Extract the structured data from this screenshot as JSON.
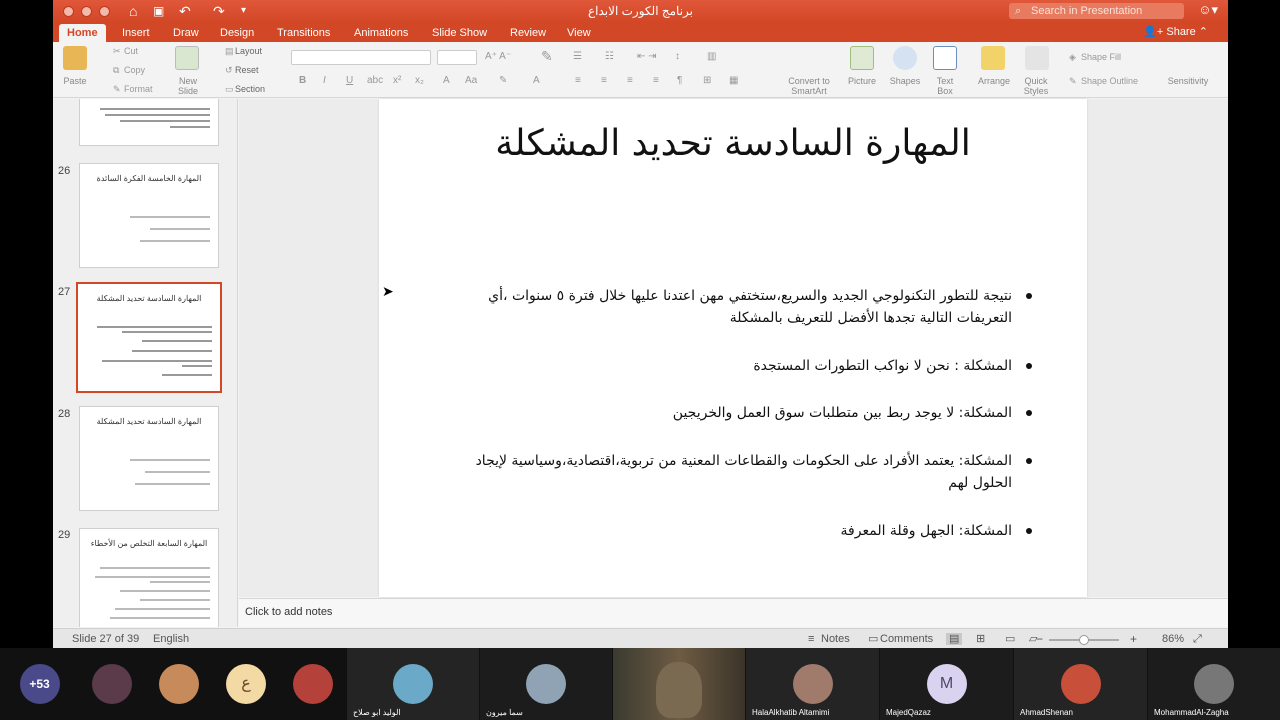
{
  "window": {
    "title": "برنامج الكورت الابداع"
  },
  "search": {
    "placeholder": "Search in Presentation"
  },
  "share_label": "Share",
  "tabs": [
    "Home",
    "Insert",
    "Draw",
    "Design",
    "Transitions",
    "Animations",
    "Slide Show",
    "Review",
    "View"
  ],
  "ribbon": {
    "paste": "Paste",
    "cut": "Cut",
    "copy": "Copy",
    "format": "Format",
    "new_slide": "New Slide",
    "layout": "Layout",
    "reset": "Reset",
    "section": "Section",
    "convert": "Convert to SmartArt",
    "picture": "Picture",
    "shapes": "Shapes",
    "text_box": "Text Box",
    "arrange": "Arrange",
    "quick_styles": "Quick Styles",
    "shape_fill": "Shape Fill",
    "shape_outline": "Shape Outline",
    "sensitivity": "Sensitivity"
  },
  "thumbnails": [
    {
      "number": "",
      "title": ""
    },
    {
      "number": "26",
      "title": "المهارة الخامسة الفكرة السائدة"
    },
    {
      "number": "27",
      "title": "المهارة السادسة تحديد المشكلة"
    },
    {
      "number": "28",
      "title": "المهارة السادسة تحديد المشكلة"
    },
    {
      "number": "29",
      "title": "المهارة السابعة التخلص من الأخطاء"
    }
  ],
  "slide": {
    "title": "المهارة السادسة تحديد المشكلة",
    "bullets": [
      "نتيجة للتطور التكنولوجي الجديد والسريع،ستختفي مهن اعتدنا عليها خلال فترة ٥ سنوات ،أي التعريفات التالية تجدها الأفضل للتعريف بالمشكلة",
      "المشكلة : نحن لا نواكب التطورات المستجدة",
      "المشكلة: لا يوجد ربط بين متطلبات سوق العمل والخريجين",
      "المشكلة: يعتمد الأفراد على الحكومات والقطاعات المعنية من تربوية،اقتصادية،وسياسية لإيجاد الحلول لهم",
      "المشكلة: الجهل وقلة المعرفة"
    ]
  },
  "notes_placeholder": "Click to add notes",
  "status": {
    "slide_of": "Slide 27 of 39",
    "language": "English",
    "notes": "Notes",
    "comments": "Comments",
    "zoom": "86%"
  },
  "call": {
    "more_count": "+53",
    "participants": [
      {
        "name": "",
        "initial": "",
        "color": "#5b3a4a"
      },
      {
        "name": "",
        "initial": "",
        "color": "#c78a5a"
      },
      {
        "name": "",
        "initial": "ع",
        "color": "#f3d9a4"
      },
      {
        "name": "",
        "initial": "",
        "color": "#b5423a"
      },
      {
        "name": "الوليد ابو صلاح",
        "initial": "",
        "color": "#6aa9c7"
      },
      {
        "name": "سما ميرون",
        "initial": "",
        "color": "#8fa3b5"
      },
      {
        "name": "",
        "initial": "",
        "color": "#7a6a52"
      },
      {
        "name": "HalaAlkhatib Altamimi",
        "initial": "",
        "color": "#a07a6a"
      },
      {
        "name": "MajedQazaz",
        "initial": "M",
        "color": "#d9d3ef"
      },
      {
        "name": "AhmadShenan",
        "initial": "",
        "color": "#c8503a"
      },
      {
        "name": "MohammadAl-Zagha",
        "initial": "",
        "color": "#777777"
      }
    ]
  }
}
